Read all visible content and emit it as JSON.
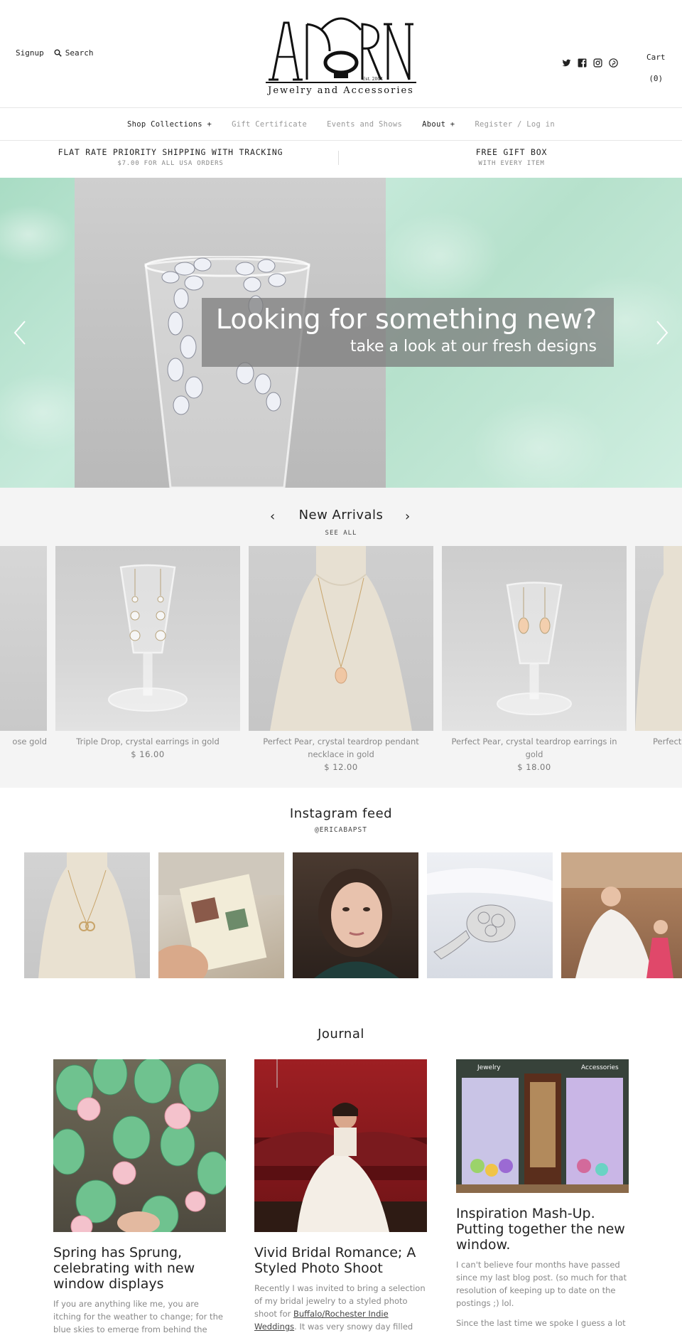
{
  "header": {
    "signup": "Signup",
    "search": "Search",
    "logo_text": "ADORN",
    "logo_est": "Est. 2004",
    "logo_tagline": "Jewelry and Accessories",
    "social_icons": [
      "twitter-icon",
      "facebook-icon",
      "instagram-icon",
      "pinterest-icon"
    ],
    "cart_label": "Cart",
    "cart_count": "(0)"
  },
  "nav": {
    "items": [
      {
        "label": "Shop Collections +",
        "active": true
      },
      {
        "label": "Gift Certificate",
        "active": false
      },
      {
        "label": "Events and Shows",
        "active": false
      },
      {
        "label": "About +",
        "active": true
      },
      {
        "label": "Register / Log in",
        "active": false
      }
    ]
  },
  "promo": {
    "left_title": "FLAT RATE PRIORITY SHIPPING WITH TRACKING",
    "left_sub": "$7.00 FOR ALL USA ORDERS",
    "right_title": "FREE GIFT BOX",
    "right_sub": "WITH EVERY ITEM"
  },
  "hero": {
    "title": "Looking for something new?",
    "subtitle": "take a look at our fresh designs"
  },
  "arrivals": {
    "title": "New Arrivals",
    "see_all": "SEE ALL",
    "products": [
      {
        "name": "ose gold",
        "price": ""
      },
      {
        "name": "Triple Drop, crystal earrings in gold",
        "price": "$ 16.00"
      },
      {
        "name": "Perfect Pear, crystal teardrop pendant necklace in gold",
        "price": "$ 12.00"
      },
      {
        "name": "Perfect Pear, crystal teardrop earrings in gold",
        "price": "$ 18.00"
      },
      {
        "name": "Perfect",
        "price": ""
      }
    ]
  },
  "instagram": {
    "title": "Instagram feed",
    "handle": "@ERICABAPST"
  },
  "journal": {
    "title": "Journal",
    "posts": [
      {
        "title": "Spring has Sprung, celebrating with new window displays",
        "excerpt": "If you are anything like me, you are itching for the weather to change; for the blue skies to emerge from behind the oppressive"
      },
      {
        "title": "Vivid Bridal Romance; A Styled Photo Shoot",
        "excerpt_before": "Recently I was invited to bring a selection of my bridal jewelry to a styled photo shoot for ",
        "excerpt_link": "Buffalo/Rochester Indie Weddings",
        "excerpt_after": ".  It was very snowy day filled with an incredible"
      },
      {
        "title": "Inspiration Mash-Up. Putting together the new window.",
        "excerpt": "I can't believe four months have passed since my last blog post.  (so much for that resolution of keeping up to date on the postings ;) lol.",
        "excerpt2": "Since the last time we spoke I guess a lot",
        "sign_left": "Jewelry",
        "sign_right": "Accessories"
      }
    ]
  }
}
